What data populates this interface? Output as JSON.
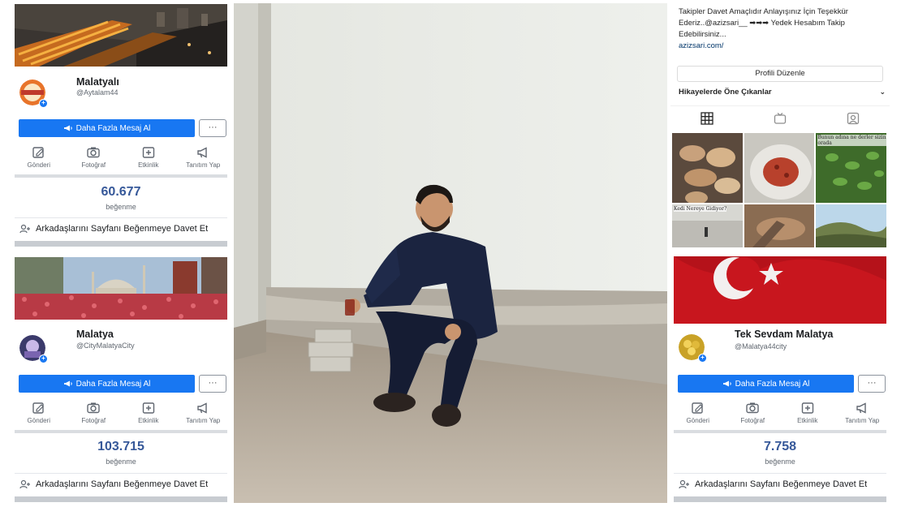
{
  "left_cards": [
    {
      "name": "Malatyalı",
      "handle": "@Aytalam44",
      "cta_label": "Daha Fazla Mesaj Al",
      "more_label": "···",
      "actions": [
        "Gönderi",
        "Fotoğraf",
        "Etkinlik",
        "Tanıtım Yap"
      ],
      "likes_count": "60.677",
      "likes_label": "beğenme",
      "invite_label": "Arkadaşlarını Sayfanı Beğenmeye Davet Et"
    },
    {
      "name": "Malatya",
      "handle": "@CityMalatyaCity",
      "cta_label": "Daha Fazla Mesaj Al",
      "more_label": "···",
      "actions": [
        "Gönderi",
        "Fotoğraf",
        "Etkinlik",
        "Tanıtım Yap"
      ],
      "likes_count": "103.715",
      "likes_label": "beğenme",
      "invite_label": "Arkadaşlarını Sayfanı Beğenmeye Davet Et"
    }
  ],
  "instagram": {
    "bio_top": "Takipler Davet Amaçlıdır Anlayışınız İçin Teşekkür Ederiz..@azizsari__ ➡➡➡ Yedek Hesabım Takip Edebilirsiniz...",
    "bio_link": "azizsari.com/",
    "edit_profile": "Profili Düzenle",
    "highlights_label": "Hikayelerde Öne Çıkanlar",
    "grid_captions": [
      "Bunun adına ne derler sizin orada",
      "Kedi Nereye Gidiyor?"
    ]
  },
  "right_card": {
    "name": "Tek Sevdam Malatya",
    "handle": "@Malatya44city",
    "cta_label": "Daha Fazla Mesaj Al",
    "more_label": "···",
    "actions": [
      "Gönderi",
      "Fotoğraf",
      "Etkinlik",
      "Tanıtım Yap"
    ],
    "likes_count": "7.758",
    "likes_label": "beğenme",
    "invite_label": "Arkadaşlarını Sayfanı Beğenmeye Davet Et"
  },
  "colors": {
    "facebook_blue": "#1877f2",
    "likes_blue": "#365899",
    "divider": "#dadde1"
  }
}
